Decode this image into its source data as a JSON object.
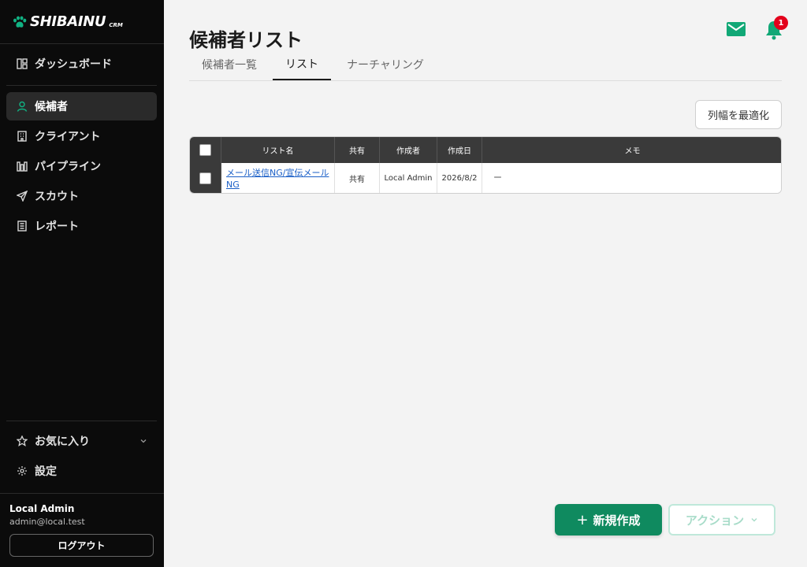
{
  "brand": {
    "name": "SHIBAINU",
    "suffix": "CRM"
  },
  "sidebar": {
    "items": [
      {
        "label": "ダッシュボード",
        "icon": "dashboard-icon"
      },
      {
        "label": "候補者",
        "icon": "user-icon",
        "active": true
      },
      {
        "label": "クライアント",
        "icon": "building-icon"
      },
      {
        "label": "パイプライン",
        "icon": "pipeline-icon"
      },
      {
        "label": "スカウト",
        "icon": "send-icon"
      },
      {
        "label": "レポート",
        "icon": "report-icon"
      }
    ],
    "favorites_label": "お気に入り",
    "settings_label": "設定"
  },
  "user": {
    "name": "Local Admin",
    "email": "admin@local.test",
    "logout_label": "ログアウト"
  },
  "header": {
    "title": "候補者リスト",
    "notification_count": "1"
  },
  "tabs": [
    {
      "label": "候補者一覧"
    },
    {
      "label": "リスト",
      "active": true
    },
    {
      "label": "ナーチャリング"
    }
  ],
  "toolbar": {
    "fit_columns_label": "列幅を最適化"
  },
  "table": {
    "columns": [
      "リスト名",
      "共有",
      "作成者",
      "作成日",
      "メモ"
    ],
    "rows": [
      {
        "name": "メール送信NG/宣伝メールNG",
        "shared": "共有",
        "creator": "Local Admin",
        "created": "2026/8/2",
        "memo": "ー"
      }
    ]
  },
  "actions": {
    "new_label": "新規作成",
    "new_plus": "+",
    "action_label": "アクション"
  },
  "colors": {
    "accent": "#0f8a5f",
    "active_icon": "#11b283",
    "badge": "#e3001b",
    "sidebar_bg": "#0b0b0b",
    "link": "#1a5fc7"
  }
}
